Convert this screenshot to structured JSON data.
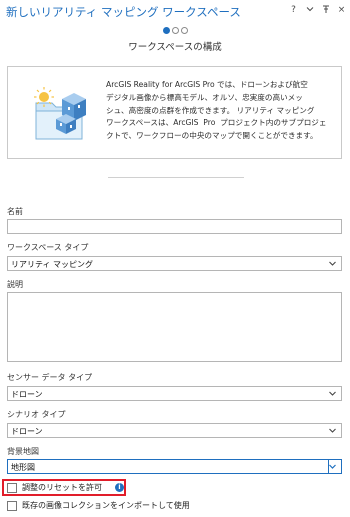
{
  "window": {
    "title": "新しいリアリティ マッピング ワークスペース",
    "controls": [
      "?",
      "⌄",
      "⊤",
      "×"
    ]
  },
  "wizard": {
    "step_title": "ワークスペースの構成",
    "steps_total": 3,
    "current_step": 1
  },
  "info_card": {
    "description": "ArcGIS Reality for ArcGIS Pro では、ドローンおよび航空\nデジタル画像から標高モデル、オルソ、忠実度の高いメッ\nシュ、高密度の点群を作成できます。 リアリティ マッピング\nワークスペースは、ArcGIS  Pro  プロジェクト内のサブプロジェ\nクトで、ワークフローの中央のマップで開くことができます。"
  },
  "form": {
    "name_label": "名前",
    "name_value": "",
    "workspace_type_label": "ワークスペース タイプ",
    "workspace_type_value": "リアリティ マッピング",
    "description_label": "説明",
    "description_value": "",
    "sensor_type_label": "センサー データ タイプ",
    "sensor_type_value": "ドローン",
    "scenario_type_label": "シナリオ タイプ",
    "scenario_type_value": "ドローン",
    "basemap_label": "背景地図",
    "basemap_value": "地形図",
    "allow_reset_label": "調整のリセットを許可",
    "allow_reset_checked": false,
    "import_collection_label": "既存の画像コレクションをインポートして使用",
    "import_collection_checked": false
  },
  "colors": {
    "accent": "#1f6fbf",
    "highlight": "#e11d2a"
  },
  "icons": {
    "help": "help-icon",
    "collapse": "chevron-down-icon",
    "pin": "pin-icon",
    "close": "close-icon",
    "info": "info-icon"
  }
}
